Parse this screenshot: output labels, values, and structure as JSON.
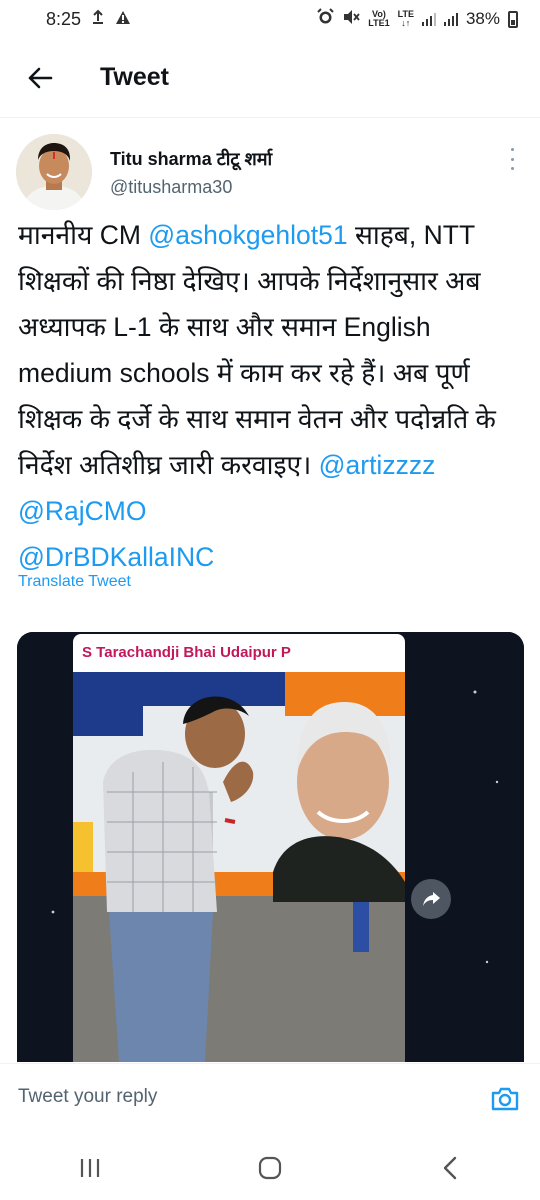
{
  "status_bar": {
    "time": "8:25",
    "battery": "38%",
    "network_top": "Vo)",
    "network_bottom": "LTE1",
    "lte": "LTE"
  },
  "header": {
    "title": "Tweet"
  },
  "tweet": {
    "author_name": "Titu sharma टीटू शर्मा",
    "author_handle": "@titusharma30",
    "text_part1": "माननीय CM ",
    "mention1": "@ashokgehlot51",
    "text_part2": " साहब, NTT शिक्षकों की निष्ठा देखिए। आपके निर्देशानुसार अब अध्यापक L-1 के साथ और समान English medium schools में काम कर रहे हैं। अब पूर्ण शिक्षक के दर्जे के साथ समान वेतन और पदोन्नति के निर्देश अतिशीघ्र जारी करवाइए। ",
    "mention2": "@artizzzz",
    "space": " ",
    "mention3": "@RajCMO",
    "mention4": "@DrBDKallaINC",
    "translate_label": "Translate Tweet",
    "media_caption": "S Tarachandji Bhai Udaipur P"
  },
  "reply": {
    "placeholder": "Tweet your reply"
  },
  "colors": {
    "link": "#1d9bf0",
    "text": "#0f1419",
    "muted": "#536471"
  },
  "icons": [
    "back-arrow-icon",
    "more-vertical-icon",
    "share-icon",
    "camera-icon",
    "recent-apps-icon",
    "home-icon",
    "back-icon",
    "alarm-icon",
    "mute-icon",
    "upload-icon",
    "alert-icon"
  ]
}
